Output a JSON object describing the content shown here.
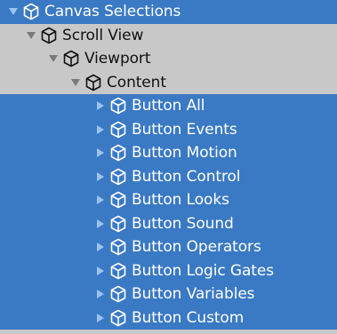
{
  "hierarchy": {
    "items": [
      {
        "label": "Canvas Selections",
        "expanded": true,
        "selected": true,
        "icon": "gameobject-cube-icon"
      },
      {
        "label": "Scroll View",
        "expanded": true,
        "selected": false,
        "icon": "gameobject-cube-icon"
      },
      {
        "label": "Viewport",
        "expanded": true,
        "selected": false,
        "icon": "gameobject-cube-icon"
      },
      {
        "label": "Content",
        "expanded": true,
        "selected": false,
        "icon": "gameobject-cube-icon"
      },
      {
        "label": "Button All",
        "expanded": false,
        "selected": true,
        "icon": "gameobject-cube-icon"
      },
      {
        "label": "Button Events",
        "expanded": false,
        "selected": true,
        "icon": "gameobject-cube-icon"
      },
      {
        "label": "Button Motion",
        "expanded": false,
        "selected": true,
        "icon": "gameobject-cube-icon"
      },
      {
        "label": "Button Control",
        "expanded": false,
        "selected": true,
        "icon": "gameobject-cube-icon"
      },
      {
        "label": "Button Looks",
        "expanded": false,
        "selected": true,
        "icon": "gameobject-cube-icon"
      },
      {
        "label": "Button Sound",
        "expanded": false,
        "selected": true,
        "icon": "gameobject-cube-icon"
      },
      {
        "label": "Button Operators",
        "expanded": false,
        "selected": true,
        "icon": "gameobject-cube-icon"
      },
      {
        "label": "Button Logic Gates",
        "expanded": false,
        "selected": true,
        "icon": "gameobject-cube-icon"
      },
      {
        "label": "Button Variables",
        "expanded": false,
        "selected": true,
        "icon": "gameobject-cube-icon"
      },
      {
        "label": "Button Custom",
        "expanded": false,
        "selected": true,
        "icon": "gameobject-cube-icon"
      }
    ]
  },
  "colors": {
    "selected_bg": "#3a79c4",
    "unselected_bg": "#c8c8c8",
    "selected_text": "#ffffff",
    "unselected_text": "#111111",
    "selected_arrow": "#9cc3f0",
    "unselected_arrow": "#7a7a7a"
  }
}
